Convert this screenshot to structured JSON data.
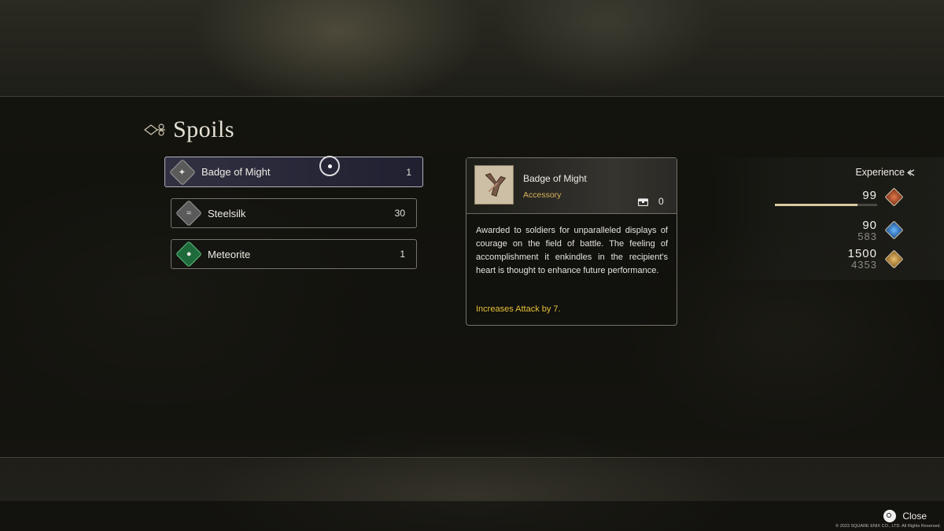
{
  "title": "Spoils",
  "items": [
    {
      "name": "Badge of Might",
      "qty": "1",
      "icon": "badge-icon",
      "selected": true
    },
    {
      "name": "Steelsilk",
      "qty": "30",
      "icon": "cloth-icon",
      "selected": false
    },
    {
      "name": "Meteorite",
      "qty": "1",
      "icon": "meteorite-icon",
      "selected": false
    }
  ],
  "detail": {
    "name": "Badge of Might",
    "type": "Accessory",
    "owned": "0",
    "description": "Awarded to soldiers for unparalleled displays of courage on the field of battle. The feeling of accomplishment it enkindles in the recipient's heart is thought to enhance future performance.",
    "effect": "Increases Attack by 7."
  },
  "experience": {
    "label": "Experience",
    "rows": [
      {
        "main": "99",
        "sub": "",
        "color": "#c04a24",
        "icon": "level-icon"
      },
      {
        "main": "90",
        "sub": "583",
        "color": "#2f7ad0",
        "icon": "ability-points-icon"
      },
      {
        "main": "1500",
        "sub": "4353",
        "color": "#c89030",
        "icon": "gil-icon"
      }
    ],
    "bar_fraction": 0.81
  },
  "close_label": "Close",
  "copyright": "© 2023 SQUARE ENIX CO., LTD. All Rights Reserved."
}
